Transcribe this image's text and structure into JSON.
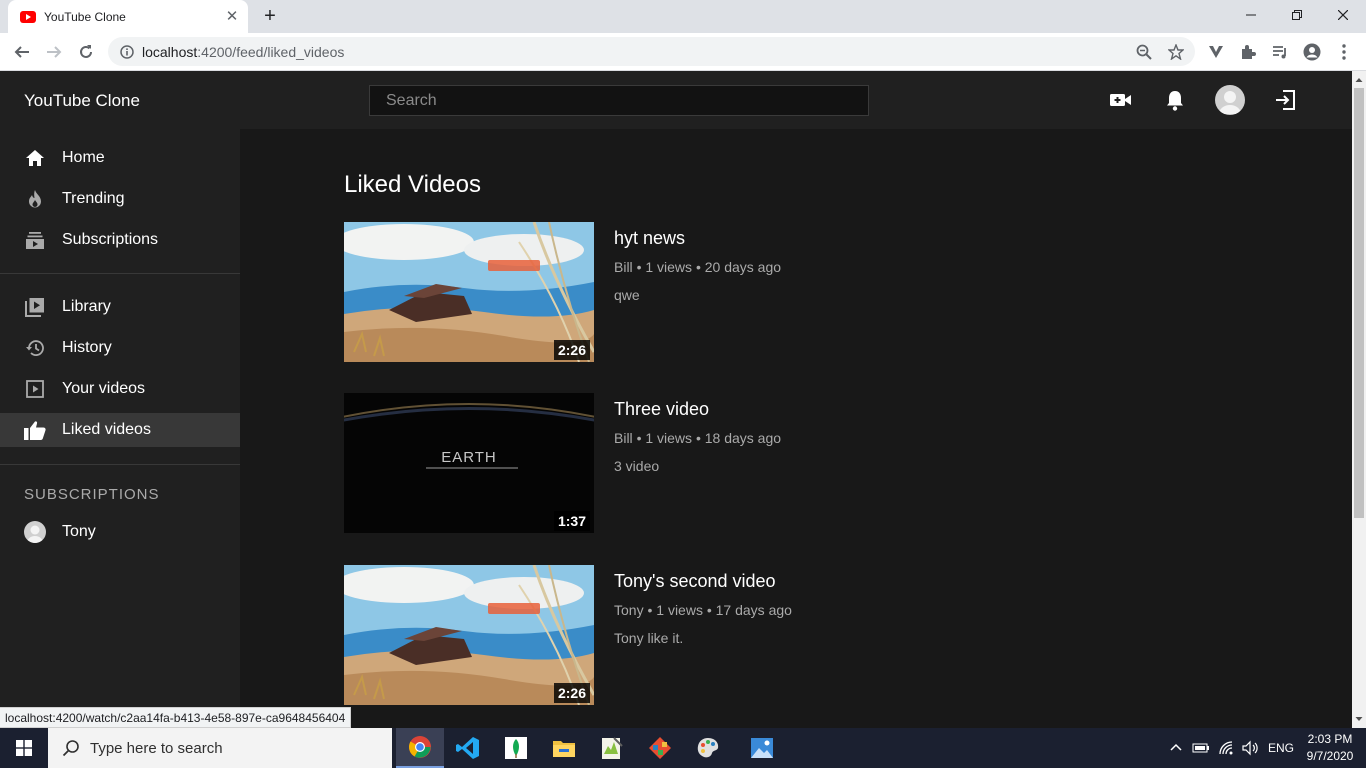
{
  "browser": {
    "tab_title": "YouTube Clone",
    "url_host": "localhost",
    "url_rest": ":4200/feed/liked_videos",
    "status_url": "localhost:4200/watch/c2aa14fa-b413-4e58-897e-ca9648456404"
  },
  "app": {
    "title": "YouTube Clone",
    "search_placeholder": "Search"
  },
  "sidebar": {
    "items": [
      {
        "label": "Home",
        "icon": "home-icon",
        "active": false
      },
      {
        "label": "Trending",
        "icon": "fire-icon",
        "active": false
      },
      {
        "label": "Subscriptions",
        "icon": "subscriptions-icon",
        "active": false
      },
      {
        "label": "Library",
        "icon": "library-icon",
        "active": false
      },
      {
        "label": "History",
        "icon": "history-icon",
        "active": false
      },
      {
        "label": "Your videos",
        "icon": "your-videos-icon",
        "active": false
      },
      {
        "label": "Liked videos",
        "icon": "thumbs-up-icon",
        "active": true
      }
    ],
    "subscriptions_heading": "SUBSCRIPTIONS",
    "subscriptions": [
      {
        "name": "Tony"
      }
    ]
  },
  "main": {
    "page_title": "Liked Videos",
    "videos": [
      {
        "title": "hyt news",
        "channel": "Bill",
        "views": "1 views",
        "age": "20 days ago",
        "description": "qwe",
        "duration": "2:26",
        "thumb": "desert"
      },
      {
        "title": "Three video",
        "channel": "Bill",
        "views": "1 views",
        "age": "18 days ago",
        "description": "3 video",
        "duration": "1:37",
        "thumb": "earth",
        "thumb_text": "EARTH"
      },
      {
        "title": "Tony's second video",
        "channel": "Tony",
        "views": "1 views",
        "age": "17 days ago",
        "description": "Tony like it.",
        "duration": "2:26",
        "thumb": "desert"
      }
    ]
  },
  "taskbar": {
    "search_text": "Type here to search",
    "language": "ENG",
    "time": "2:03 PM",
    "date": "9/7/2020"
  },
  "colors": {
    "app_bg": "#181818",
    "header_bg": "#202020",
    "sidebar_active": "#383838",
    "brand_red": "#ff0000"
  }
}
